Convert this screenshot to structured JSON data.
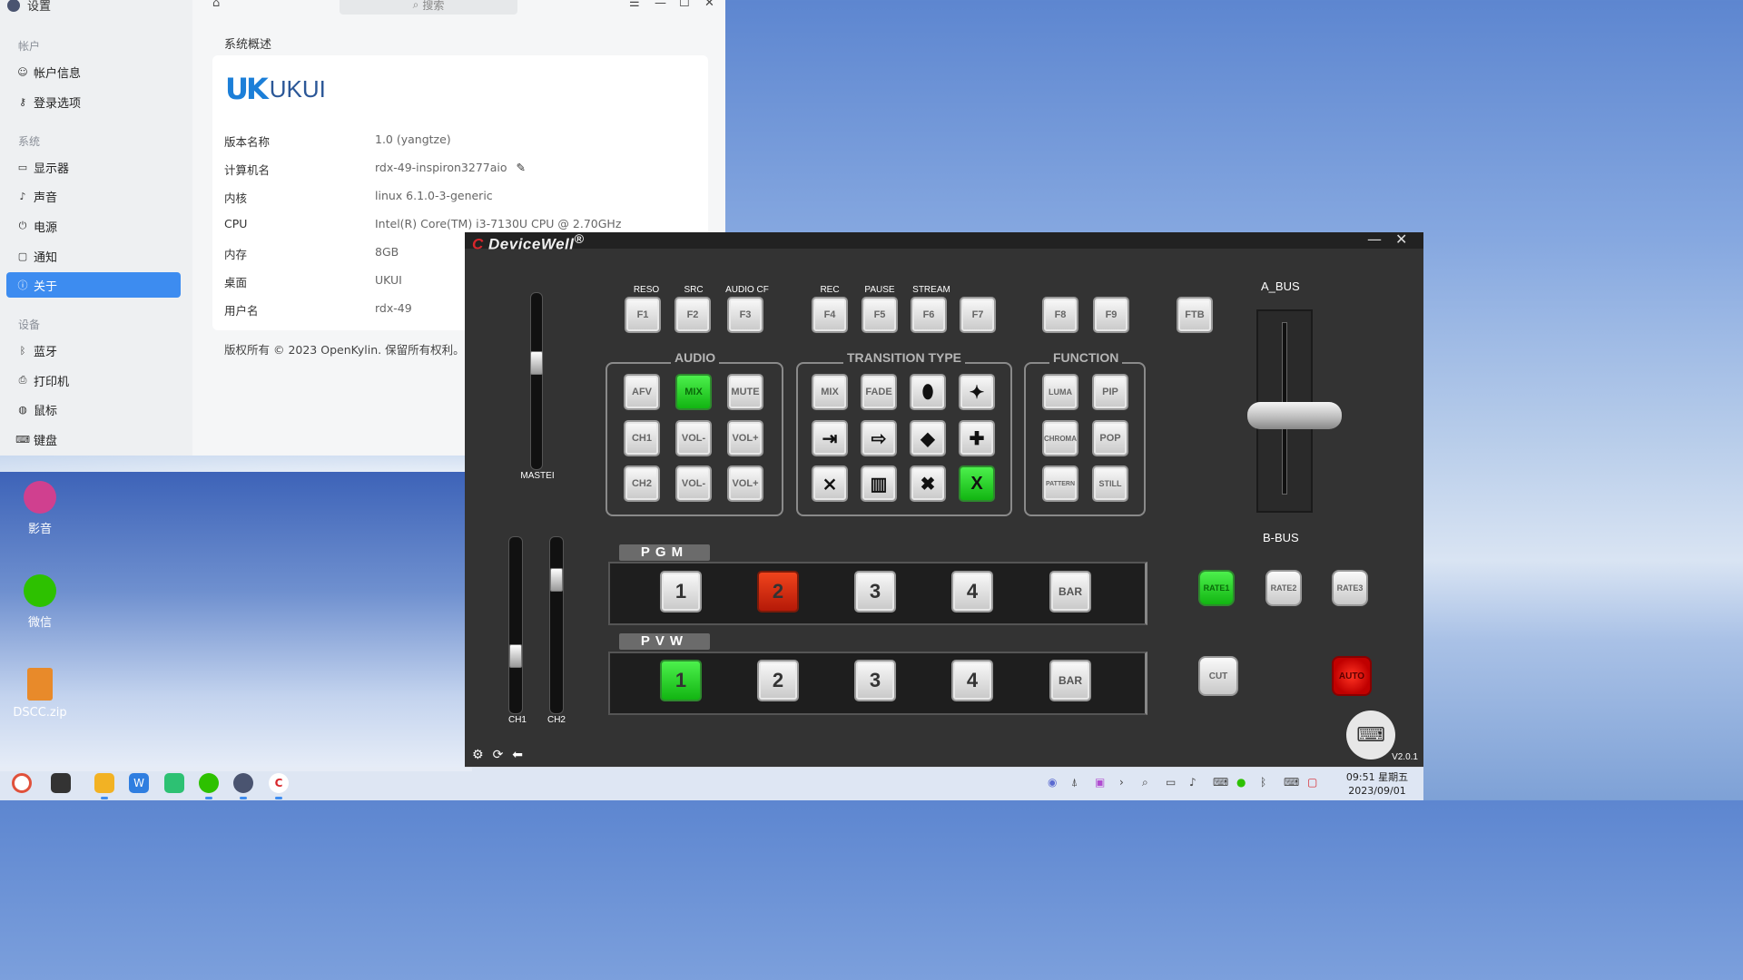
{
  "settings": {
    "app_title": "设置",
    "sidebar": {
      "sections": [
        {
          "label": "帐户",
          "items": [
            {
              "label": "帐户信息",
              "icon": "user-icon"
            },
            {
              "label": "登录选项",
              "icon": "key-icon"
            }
          ]
        },
        {
          "label": "系统",
          "items": [
            {
              "label": "显示器",
              "icon": "monitor-icon"
            },
            {
              "label": "声音",
              "icon": "speaker-icon"
            },
            {
              "label": "电源",
              "icon": "power-icon"
            },
            {
              "label": "通知",
              "icon": "message-icon"
            },
            {
              "label": "关于",
              "icon": "info-icon",
              "active": true
            }
          ]
        },
        {
          "label": "设备",
          "items": [
            {
              "label": "蓝牙",
              "icon": "bluetooth-icon"
            },
            {
              "label": "打印机",
              "icon": "printer-icon"
            },
            {
              "label": "鼠标",
              "icon": "mouse-icon"
            },
            {
              "label": "键盘",
              "icon": "keyboard-icon"
            }
          ]
        }
      ]
    },
    "search_placeholder": "搜索",
    "page_title": "系统概述",
    "logo": {
      "mark": "UK",
      "text": "UKUI"
    },
    "info": [
      {
        "key": "版本名称",
        "value": "1.0 (yangtze)"
      },
      {
        "key": "计算机名",
        "value": "rdx-49-inspiron3277aio"
      },
      {
        "key": "内核",
        "value": "linux 6.1.0-3-generic"
      },
      {
        "key": "CPU",
        "value": "Intel(R) Core(TM) i3-7130U CPU @ 2.70GHz"
      },
      {
        "key": "内存",
        "value": "8GB"
      },
      {
        "key": "桌面",
        "value": "UKUI"
      },
      {
        "key": "用户名",
        "value": "rdx-49"
      }
    ],
    "copyright": "版权所有 © 2023 OpenKylin. 保留所有权利。"
  },
  "desktop": {
    "icons": [
      {
        "label": "影音",
        "icon": "video-player-icon",
        "color": "#d0408f"
      },
      {
        "label": "微信",
        "icon": "wechat-icon",
        "color": "#2dc100"
      },
      {
        "label": "DSCC.zip",
        "icon": "zip-file-icon",
        "color": "#e88a2a"
      }
    ]
  },
  "devicewell": {
    "brand": "DeviceWell",
    "brand_mark": "®",
    "function_keys": [
      {
        "top": "RESO",
        "key": "F1"
      },
      {
        "top": "SRC",
        "key": "F2"
      },
      {
        "top": "AUDIO CF",
        "key": "F3"
      },
      {
        "top": "REC",
        "key": "F4"
      },
      {
        "top": "PAUSE",
        "key": "F5"
      },
      {
        "top": "STREAM",
        "key": "F6"
      },
      {
        "top": "",
        "key": "F7"
      },
      {
        "top": "",
        "key": "F8"
      },
      {
        "top": "",
        "key": "F9"
      },
      {
        "top": "",
        "key": "FTB"
      }
    ],
    "audio": {
      "title": "AUDIO",
      "keys": [
        "AFV",
        "MIX",
        "MUTE",
        "CH1",
        "VOL-",
        "VOL+",
        "CH2",
        "VOL-",
        "VOL+"
      ],
      "active": "MIX"
    },
    "transition": {
      "title": "TRANSITION TYPE",
      "keys": [
        "MIX",
        "FADE",
        "⬮",
        "✦",
        "⇥",
        "⇨",
        "◆",
        "✚",
        "⨯",
        "▥",
        "✖",
        "X"
      ],
      "active_index": 11
    },
    "function": {
      "title": "FUNCTION",
      "keys": [
        "LUMA",
        "PIP",
        "CHROMA",
        "POP",
        "PATTERN",
        "STILL"
      ]
    },
    "master_label": "MASTEI",
    "ch1_label": "CH1",
    "ch2_label": "CH2",
    "pgm": {
      "label": "PGM",
      "keys": [
        "1",
        "2",
        "3",
        "4",
        "BAR"
      ],
      "active_index": 1,
      "active_color": "red"
    },
    "pvw": {
      "label": "PVW",
      "keys": [
        "1",
        "2",
        "3",
        "4",
        "BAR"
      ],
      "active_index": 0,
      "active_color": "green"
    },
    "a_bus": "A_BUS",
    "b_bus": "B-BUS",
    "rates": [
      "RATE1",
      "RATE2",
      "RATE3"
    ],
    "active_rate": "RATE1",
    "cut": "CUT",
    "auto": "AUTO",
    "version": "V2.0.1",
    "colors": {
      "active_green": "#22d022",
      "active_red": "#d8262b",
      "panel_bg": "#333333"
    }
  },
  "taskbar": {
    "apps": [
      "browser-icon",
      "multitask-icon",
      "files-icon",
      "wps-icon",
      "message-icon",
      "wechat-icon",
      "settings-icon",
      "devicewell-icon"
    ],
    "tray": [
      "ukui-icon",
      "network-share-icon",
      "video-icon",
      "chevron-right-icon",
      "search-icon",
      "display-icon",
      "volume-icon",
      "keyboard-icon",
      "wechat-tray-icon",
      "bluetooth-icon",
      "notification-icon"
    ],
    "time": "09:51 星期五",
    "date": "2023/09/01"
  }
}
